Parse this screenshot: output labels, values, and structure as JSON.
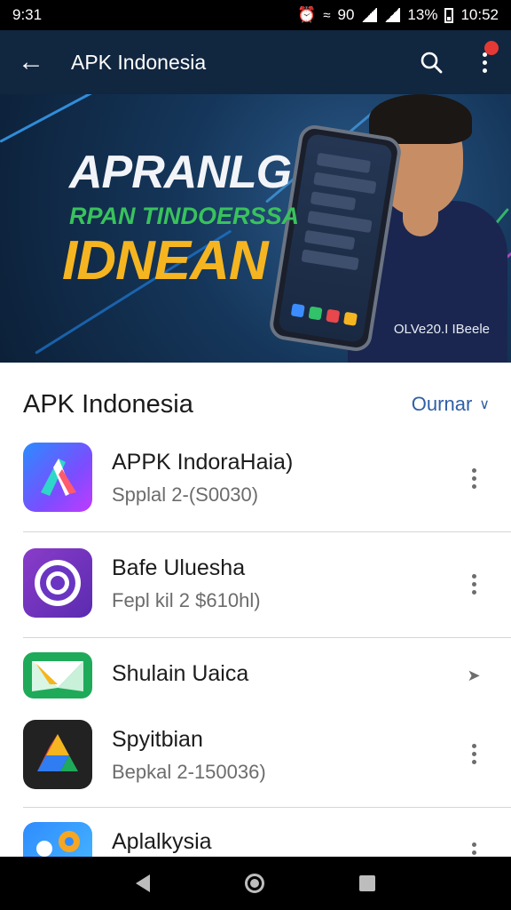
{
  "status_bar": {
    "time": "9:31",
    "wifi_level": "90",
    "battery": "13%",
    "clock": "10:52"
  },
  "app_bar": {
    "title": "APK Indonesia"
  },
  "banner": {
    "headline": "APRANLG",
    "subheadline": "RPAN TINDOERSSA",
    "bigline": "IDNEAN",
    "tag": "OLVe20.I IBeele"
  },
  "section": {
    "title": "APK Indonesia",
    "link": "Ournar"
  },
  "apps": [
    {
      "title": "APPK IndoraHaia)",
      "subtitle": "Spplal 2-(S0030)",
      "icon": "arrow-gradient-icon",
      "menu": "more-vert-icon"
    },
    {
      "title": "Bafe Uluesha",
      "subtitle": "Fepl kil 2 $610hl)",
      "icon": "target-icon",
      "menu": "more-vert-icon"
    },
    {
      "title": "Shulain Uaica",
      "subtitle": "",
      "icon": "mail-icon",
      "menu": "arrow-icon"
    },
    {
      "title": "Spyitbian",
      "subtitle": "Bepkal 2-150036)",
      "icon": "drive-triangle-icon",
      "menu": "more-vert-icon"
    },
    {
      "title": "Aplalkysia",
      "subtitle": "",
      "icon": "settings-gears-icon",
      "menu": "more-vert-icon"
    }
  ],
  "colors": {
    "app_bar": "#11263f",
    "link": "#2f5fa6",
    "banner_accent_green": "#39c25c",
    "banner_accent_yellow": "#f5b521"
  }
}
